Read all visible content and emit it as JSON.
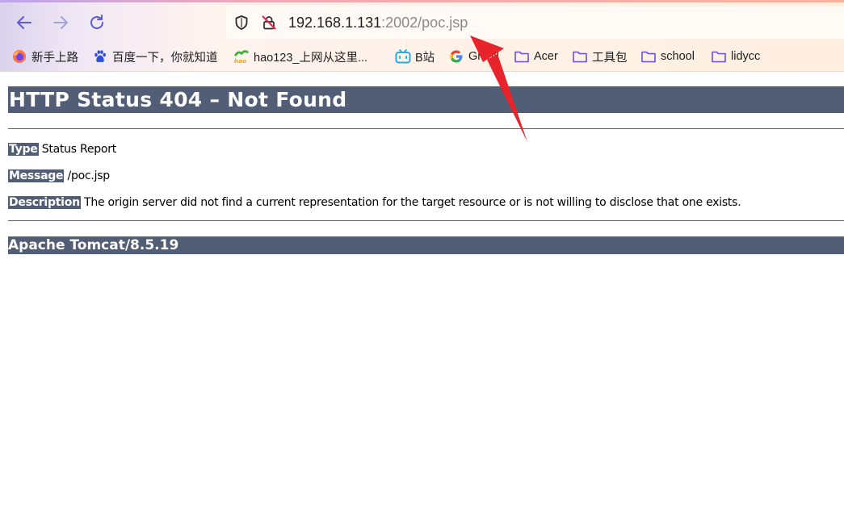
{
  "browser": {
    "url": {
      "host": "192.168.1.131",
      "path": ":2002/poc.jsp"
    },
    "bookmarks": [
      {
        "label": "新手上路",
        "icon": "firefox-icon"
      },
      {
        "label": "百度一下，你就知道",
        "icon": "baidu-paw-icon"
      },
      {
        "label": "hao123_上网从这里...",
        "icon": "hao123-icon"
      },
      {
        "label": "B站",
        "icon": "bilibili-tv-icon"
      },
      {
        "label": "Gmail",
        "icon": "google-g-icon"
      },
      {
        "label": "Acer",
        "icon": "folder-icon"
      },
      {
        "label": "工具包",
        "icon": "folder-icon"
      },
      {
        "label": "school",
        "icon": "folder-icon"
      },
      {
        "label": "lidycc",
        "icon": "folder-icon"
      }
    ]
  },
  "page": {
    "title": "HTTP Status 404 – Not Found",
    "type_label": "Type",
    "type_value": "Status Report",
    "message_label": "Message",
    "message_value": "/poc.jsp",
    "description_label": "Description",
    "description_value": "The origin server did not find a current representation for the target resource or is not willing to disclose that one exists.",
    "footer": "Apache Tomcat/8.5.19"
  },
  "colors": {
    "tomcat_header": "#525d76",
    "annotation_arrow": "#e8232a",
    "folder_icon": "#6b4fd8"
  }
}
